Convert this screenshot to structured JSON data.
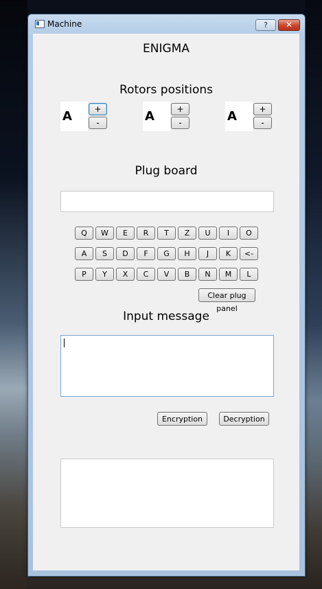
{
  "window": {
    "title": "Machine",
    "help_label": "?",
    "close_label": "✕"
  },
  "app": {
    "heading": "ENIGMA",
    "rotors_title": "Rotors positions",
    "rotors": [
      {
        "value": "A",
        "plus": "+",
        "minus": "-"
      },
      {
        "value": "A",
        "plus": "+",
        "minus": "-"
      },
      {
        "value": "A",
        "plus": "+",
        "minus": "-"
      }
    ],
    "plug_title": "Plug board",
    "plug_value": "",
    "keyboard": {
      "row1": [
        "Q",
        "W",
        "E",
        "R",
        "T",
        "Z",
        "U",
        "I",
        "O"
      ],
      "row2": [
        "A",
        "S",
        "D",
        "F",
        "G",
        "H",
        "J",
        "K",
        "<-"
      ],
      "row3": [
        "P",
        "Y",
        "X",
        "C",
        "V",
        "B",
        "N",
        "M",
        "L"
      ]
    },
    "clear_plug_label": "Clear plug panel",
    "input_title": "Input message",
    "input_value": "",
    "encrypt_label": "Encryption",
    "decrypt_label": "Decryption",
    "output_value": ""
  }
}
